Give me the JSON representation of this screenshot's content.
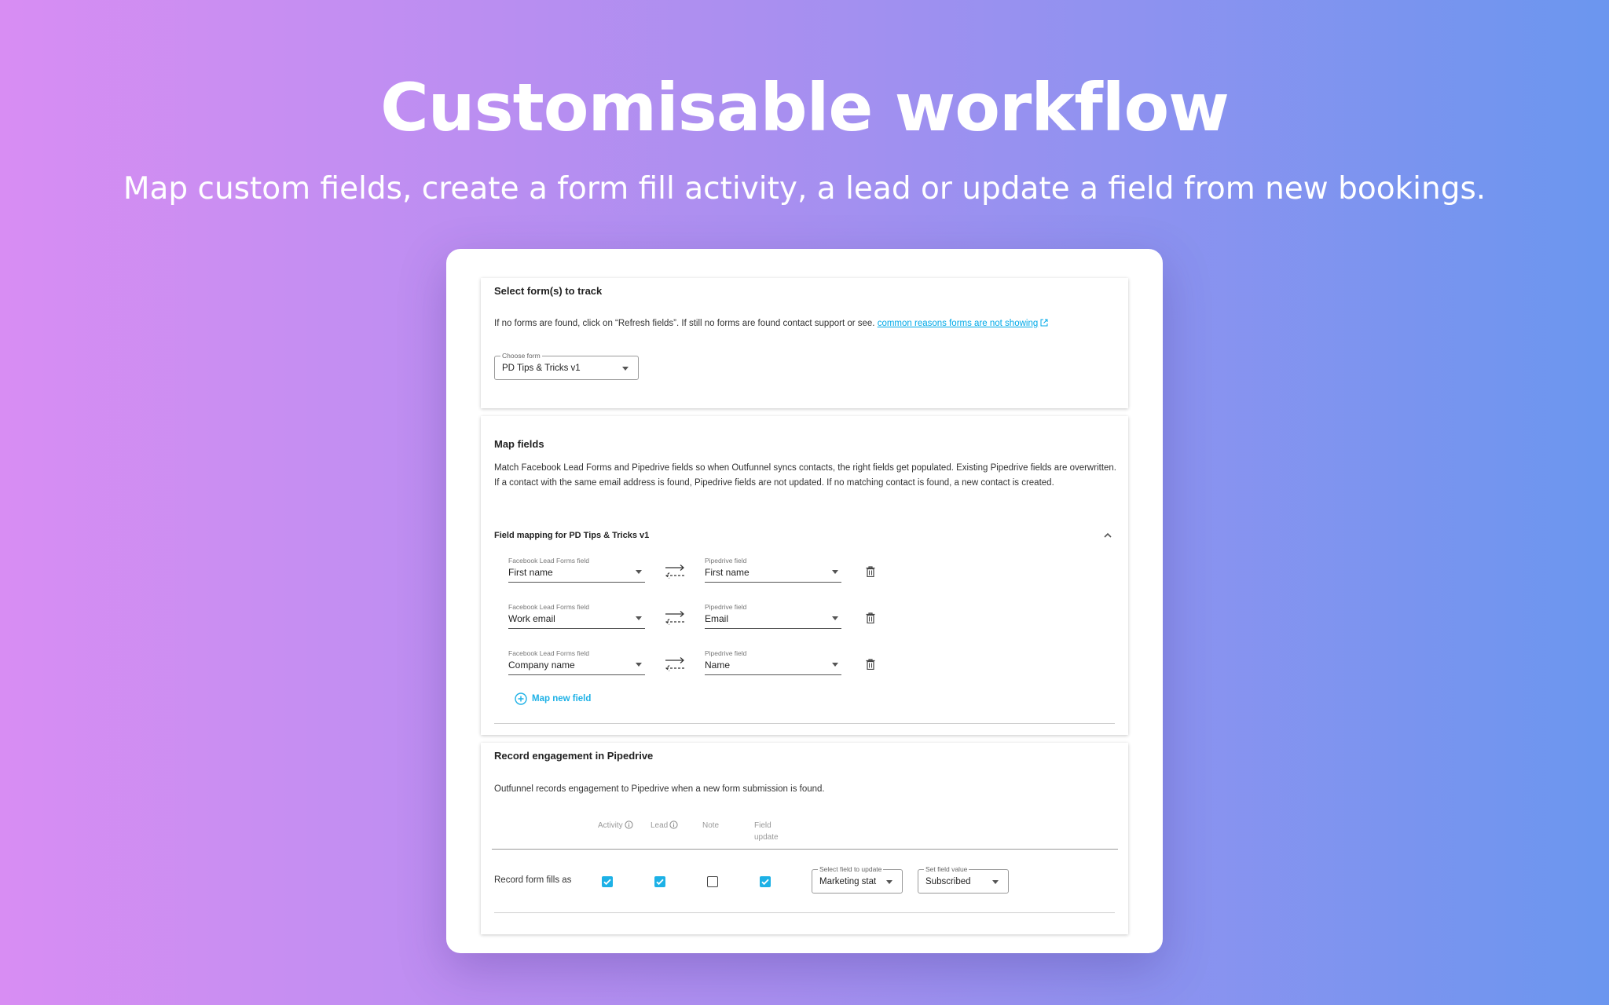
{
  "hero": {
    "title": "Customisable workflow",
    "subtitle": "Map custom fields, create a form fill activity, a lead or update a field from new bookings."
  },
  "select_forms": {
    "title": "Select form(s) to track",
    "description": "If no forms are found, click on “Refresh fields”. If still no forms are found contact support or see.",
    "link_text": "common reasons forms are not showing",
    "choose_form": {
      "label": "Choose form",
      "value": "PD Tips & Tricks v1"
    }
  },
  "map_fields": {
    "title": "Map fields",
    "description": "Match Facebook Lead Forms and Pipedrive fields so when Outfunnel syncs contacts, the right fields get populated. Existing Pipedrive fields are overwritten. If a contact with the same email address is found, Pipedrive fields are not updated. If no matching contact is found, a new contact is created.",
    "mapping_header": "Field mapping for PD Tips & Tricks v1",
    "rows": [
      {
        "source_label": "Facebook Lead Forms field",
        "source_value": "First name",
        "target_label": "Pipedrive field",
        "target_value": "First name"
      },
      {
        "source_label": "Facebook Lead Forms field",
        "source_value": "Work email",
        "target_label": "Pipedrive field",
        "target_value": "Email"
      },
      {
        "source_label": "Facebook Lead Forms field",
        "source_value": "Company name",
        "target_label": "Pipedrive field",
        "target_value": "Name"
      }
    ],
    "add_label": "Map new field"
  },
  "engagement": {
    "title": "Record engagement in Pipedrive",
    "description": "Outfunnel records engagement to Pipedrive when a new form submission is found.",
    "columns": {
      "activity": "Activity",
      "lead": "Lead",
      "note": "Note",
      "field_update_1": "Field",
      "field_update_2": "update"
    },
    "row_label": "Record form fills as",
    "checks": {
      "activity": true,
      "lead": true,
      "note": false,
      "field_update": true
    },
    "field_select": {
      "label": "Select field to update",
      "value": "Marketing stat"
    },
    "value_select": {
      "label": "Set field value",
      "value": "Subscribed"
    }
  },
  "colors": {
    "accent": "#1db1e6",
    "gradient_left": "#d88df3",
    "gradient_right": "#6b96ef"
  },
  "icons": [
    "external-link-icon",
    "chevron-up-icon",
    "swap-arrows-icon",
    "trash-icon",
    "add-circle-icon",
    "info-icon",
    "checkbox-icon",
    "dropdown-caret-icon"
  ]
}
